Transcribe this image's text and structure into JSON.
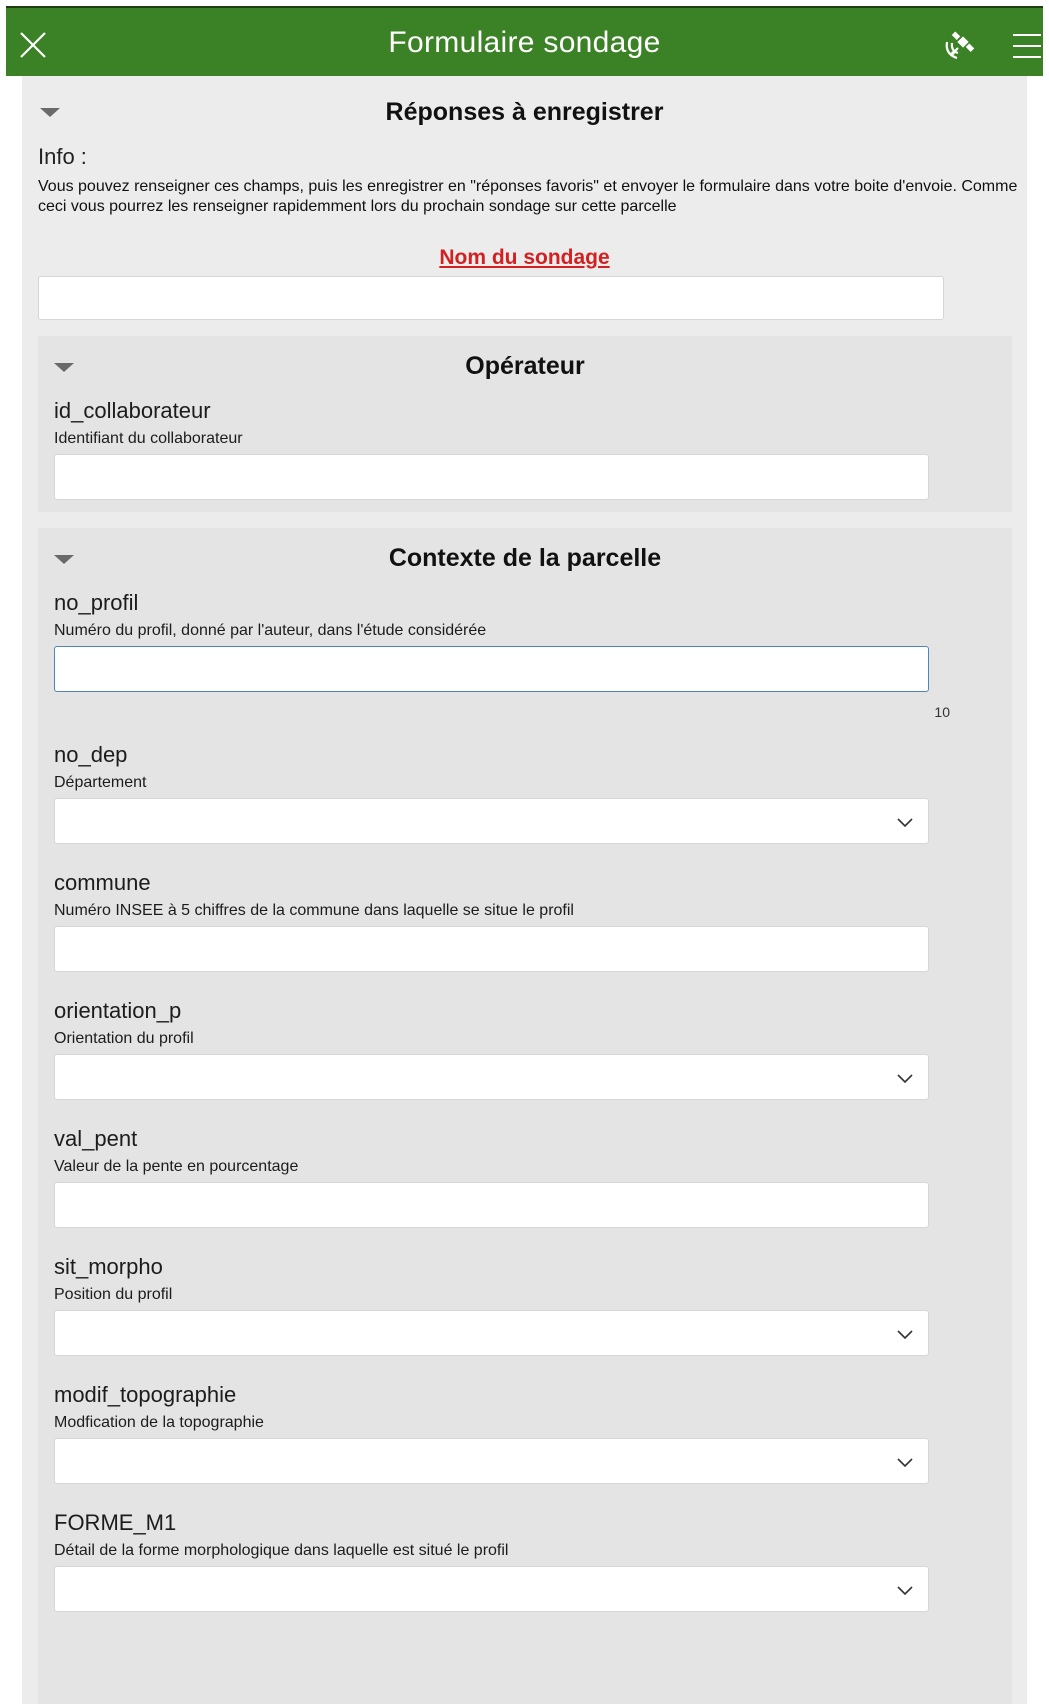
{
  "header": {
    "title": "Formulaire sondage"
  },
  "favorites_group": {
    "title": "Réponses à enregistrer",
    "info_label": "Info :",
    "info_text": "Vous pouvez renseigner ces champs, puis les enregistrer en \"réponses favoris\" et envoyer le formulaire dans votre boite d'envoie. Comme ceci vous pourrez les renseigner rapidemment lors du prochain sondage sur cette parcelle",
    "survey_name_label": "Nom du sondage",
    "survey_name_value": ""
  },
  "operator_group": {
    "title": "Opérateur",
    "fields": [
      {
        "name": "id_collaborateur",
        "hint": "Identifiant du collaborateur",
        "value": ""
      }
    ]
  },
  "context_group": {
    "title": "Contexte de la parcelle",
    "fields": [
      {
        "name": "no_profil",
        "hint": "Numéro du profil, donné par l'auteur, dans l'étude considérée",
        "value": "",
        "counter": "10"
      },
      {
        "name": "no_dep",
        "hint": "Département",
        "value": ""
      },
      {
        "name": "commune",
        "hint": "Numéro INSEE à 5 chiffres de la commune dans laquelle se situe le profil",
        "value": ""
      },
      {
        "name": "orientation_p",
        "hint": "Orientation du profil",
        "value": ""
      },
      {
        "name": "val_pent",
        "hint": "Valeur de la pente en pourcentage",
        "value": ""
      },
      {
        "name": "sit_morpho",
        "hint": "Position du profil",
        "value": ""
      },
      {
        "name": "modif_topographie",
        "hint": "Modfication de la topographie",
        "value": ""
      },
      {
        "name": "FORME_M1",
        "hint": "Détail de la forme morphologique dans laquelle est situé le profil",
        "value": ""
      }
    ]
  },
  "colors": {
    "header_bg": "#3b8126",
    "required": "#d32020",
    "panel_bg": "#ececec",
    "group_bg": "#e4e4e4",
    "focus_border": "#4f84bf"
  }
}
